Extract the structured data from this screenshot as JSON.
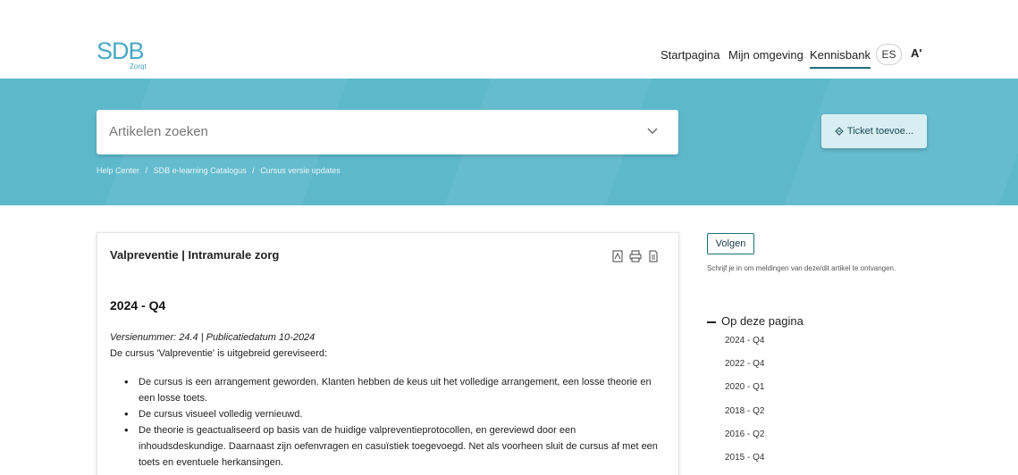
{
  "header": {
    "logo_text_main": "SDB",
    "logo_text_sub": "Zorgt",
    "nav": {
      "startpagina": "Startpagina",
      "mijn_omgeving": "Mijn omgeving",
      "kennisbank": "Kennisbank"
    },
    "lang": "ES",
    "a11y": "A'"
  },
  "hero": {
    "search_placeholder": "Artikelen zoeken",
    "breadcrumb": [
      "Help Center",
      "SDB e-learning Catalogus",
      "Cursus versie updates"
    ],
    "breadcrumb_sep": "/",
    "ticket_button": "Ticket toevoe..."
  },
  "article": {
    "title": "Valpreventie | Intramurale zorg",
    "section_heading": "2024 - Q4",
    "version_line": "Versienummer: 24.4 | Publicatiedatum 10-2024",
    "intro": "De cursus 'Valpreventie' is uitgebreid gereviseerd:",
    "bullets": [
      "De cursus is een arrangement geworden. Klanten hebben de keus uit het volledige arrangement, een losse theorie en een losse toets.",
      "De cursus visueel volledig vernieuwd.",
      "De theorie is geactualiseerd op basis van de huidige valpreventieprotocollen, en gereviewd door een inhoudsdeskundige. Daarnaast zijn oefenvragen en casuïstiek toegevoegd. Net als voorheen sluit de cursus af met een toets en eventuele herkansingen."
    ]
  },
  "sidebar": {
    "follow_button": "Volgen",
    "follow_desc": "Schrijf je in om meldingen van deze/dit artikel te ontvangen.",
    "toc_heading": "Op deze pagina",
    "toc_items": [
      "2024 - Q4",
      "2022 - Q4",
      "2020 - Q1",
      "2018 - Q2",
      "2016 - Q2",
      "2015 - Q4"
    ]
  },
  "colors": {
    "hero_bg": "#5db8cc",
    "accent": "#1f6f7a",
    "logo": "#4aa8c4"
  }
}
